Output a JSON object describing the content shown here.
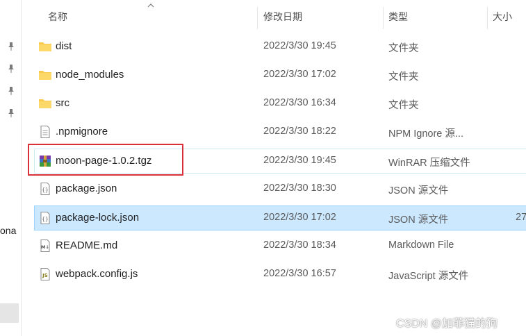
{
  "left_pane": {
    "truncated_label": "ona",
    "pin_icon": "pin-icon"
  },
  "columns": {
    "name": "名称",
    "date": "修改日期",
    "type": "类型",
    "size": "大小"
  },
  "files": [
    {
      "name": "dist",
      "date": "2022/3/30 19:45",
      "type": "文件夹",
      "size": "",
      "icon": "folder-icon"
    },
    {
      "name": "node_modules",
      "date": "2022/3/30 17:02",
      "type": "文件夹",
      "size": "",
      "icon": "folder-icon"
    },
    {
      "name": "src",
      "date": "2022/3/30 16:34",
      "type": "文件夹",
      "size": "",
      "icon": "folder-icon"
    },
    {
      "name": ".npmignore",
      "date": "2022/3/30 18:22",
      "type": "NPM Ignore 源...",
      "size": "",
      "icon": "text-file-icon"
    },
    {
      "name": "moon-page-1.0.2.tgz",
      "date": "2022/3/30 19:45",
      "type": "WinRAR 压缩文件",
      "size": "",
      "icon": "winrar-archive-icon"
    },
    {
      "name": "package.json",
      "date": "2022/3/30 18:30",
      "type": "JSON 源文件",
      "size": "",
      "icon": "json-file-icon"
    },
    {
      "name": "package-lock.json",
      "date": "2022/3/30 17:02",
      "type": "JSON 源文件",
      "size": "27",
      "icon": "json-file-icon"
    },
    {
      "name": "README.md",
      "date": "2022/3/30 18:34",
      "type": "Markdown File",
      "size": "",
      "icon": "markdown-file-icon"
    },
    {
      "name": "webpack.config.js",
      "date": "2022/3/30 16:57",
      "type": "JavaScript 源文件",
      "size": "",
      "icon": "javascript-file-icon"
    }
  ],
  "watermark": "CSDN @加菲猫的狗",
  "colors": {
    "highlight_border": "#d9303a",
    "selected_row": "#cce8ff",
    "folder": "#f8c94a"
  }
}
